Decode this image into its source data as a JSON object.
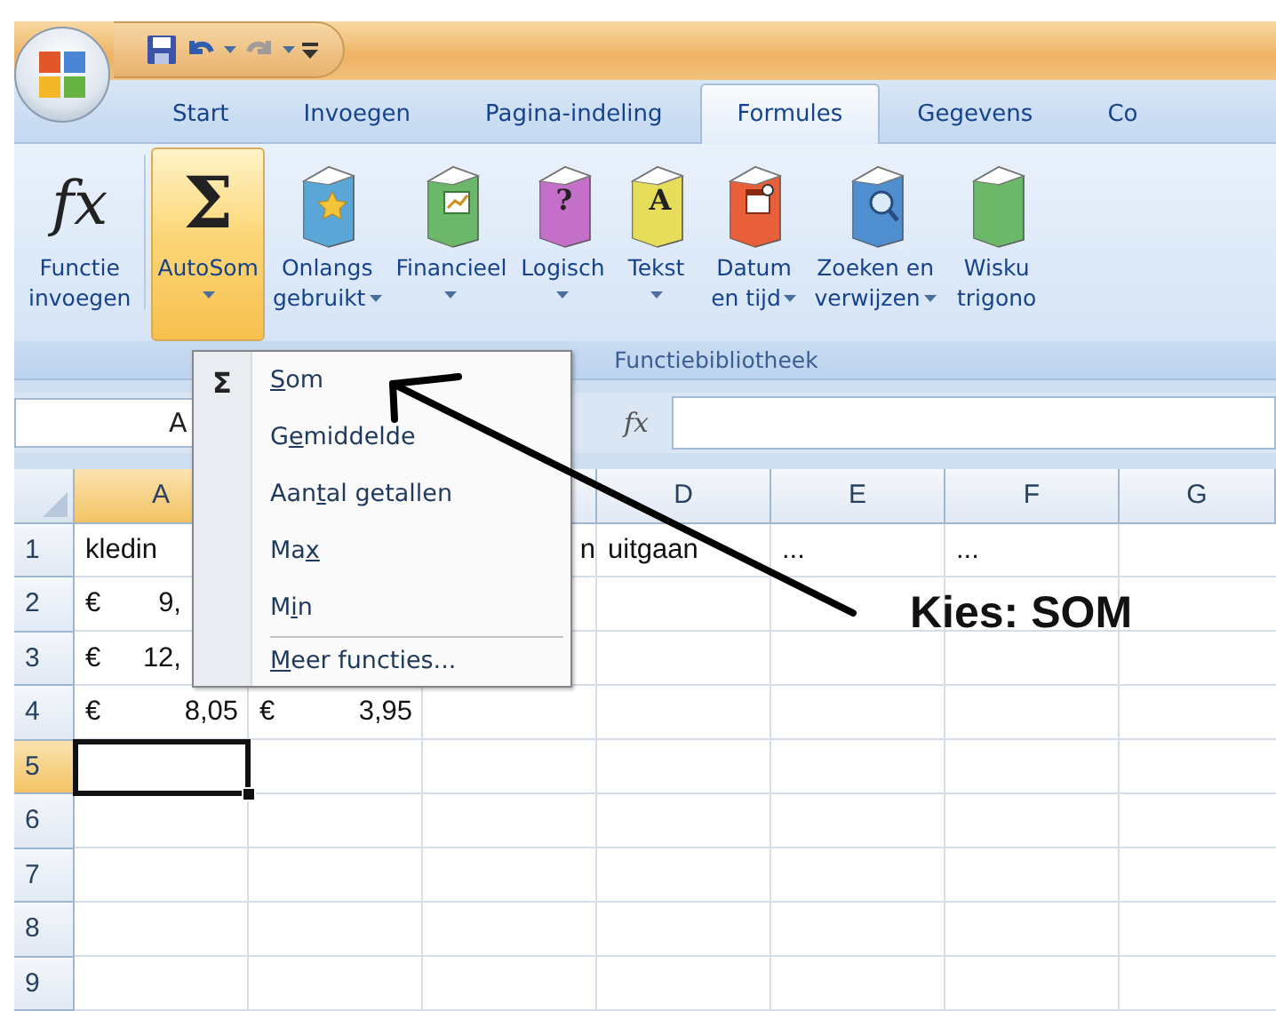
{
  "quick_access": [
    {
      "kind": "save",
      "disabled": false,
      "has_menu": false
    },
    {
      "kind": "undo",
      "disabled": false,
      "has_menu": true
    },
    {
      "kind": "redo",
      "disabled": true,
      "has_menu": true
    },
    {
      "kind": "customize",
      "disabled": false,
      "has_menu": false
    }
  ],
  "tabs": [
    {
      "label": "Start",
      "selected": false
    },
    {
      "label": "Invoegen",
      "selected": false
    },
    {
      "label": "Pagina-indeling",
      "selected": false
    },
    {
      "label": "Formules",
      "selected": true
    },
    {
      "label": "Gegevens",
      "selected": false
    },
    {
      "label": "Co",
      "selected": false
    }
  ],
  "ribbon": {
    "buttons": [
      {
        "kind": "function",
        "lines": [
          "Functie",
          "invoegen"
        ],
        "glyph": "fx",
        "has_menu": false,
        "active": false
      },
      {
        "kind": "sum",
        "lines": [
          "AutoSom"
        ],
        "glyph": "Σ",
        "has_menu": true,
        "active": true
      },
      {
        "kind": "recent",
        "lines": [
          "Onlangs",
          "gebruikt"
        ],
        "color": "#5aa6d6",
        "has_menu": true,
        "active": false
      },
      {
        "kind": "financial",
        "lines": [
          "Financieel"
        ],
        "color": "#6cb86a",
        "has_menu": true,
        "active": false
      },
      {
        "kind": "logical",
        "lines": [
          "Logisch"
        ],
        "color": "#c46fc8",
        "emblem_text": "?",
        "has_menu": true,
        "active": false
      },
      {
        "kind": "text",
        "lines": [
          "Tekst"
        ],
        "color": "#e6de5a",
        "emblem_text": "A",
        "has_menu": true,
        "active": false
      },
      {
        "kind": "date",
        "lines": [
          "Datum",
          "en tijd"
        ],
        "color": "#e8603a",
        "has_menu": true,
        "active": false
      },
      {
        "kind": "lookup",
        "lines": [
          "Zoeken en",
          "verwijzen"
        ],
        "color": "#4f8fd0",
        "has_menu": true,
        "active": false
      },
      {
        "kind": "math",
        "lines": [
          "Wisku",
          "trigono"
        ],
        "color": "#6cb86a",
        "has_menu": false,
        "active": false
      }
    ],
    "group_label": "Functiebibliotheek"
  },
  "name_box": "A",
  "formula_icon": "fx",
  "columns": [
    {
      "label": "A",
      "selected": true
    },
    null,
    null,
    {
      "label": "D",
      "selected": false
    },
    {
      "label": "E",
      "selected": false
    },
    {
      "label": "F",
      "selected": false
    },
    {
      "label": "G",
      "selected": false
    }
  ],
  "rows": [
    {
      "header": "1",
      "selected": false,
      "cells": [
        {
          "text": "kledin"
        },
        null,
        {
          "text": "n",
          "right_aligned": true
        },
        {
          "text": "uitgaan"
        },
        {
          "text": "..."
        },
        {
          "text": "..."
        },
        null
      ]
    },
    {
      "header": "2",
      "selected": false,
      "cells": [
        {
          "currency": "€",
          "amount": "9,",
          "covered": true
        },
        null,
        null,
        null,
        null,
        null,
        null
      ]
    },
    {
      "header": "3",
      "selected": false,
      "cells": [
        {
          "currency": "€",
          "amount": "12,",
          "covered": true
        },
        null,
        null,
        null,
        null,
        null,
        null
      ]
    },
    {
      "header": "4",
      "selected": false,
      "cells": [
        {
          "currency": "€",
          "amount": "8,05"
        },
        {
          "currency": "€",
          "amount": "3,95"
        },
        null,
        null,
        null,
        null,
        null
      ]
    },
    {
      "header": "5",
      "selected": true,
      "cells": [
        null,
        null,
        null,
        null,
        null,
        null,
        null
      ]
    },
    {
      "header": "6",
      "selected": false,
      "cells": [
        null,
        null,
        null,
        null,
        null,
        null,
        null
      ]
    },
    {
      "header": "7",
      "selected": false,
      "cells": [
        null,
        null,
        null,
        null,
        null,
        null,
        null
      ]
    },
    {
      "header": "8",
      "selected": false,
      "cells": [
        null,
        null,
        null,
        null,
        null,
        null,
        null
      ]
    },
    {
      "header": "9",
      "selected": false,
      "cells": [
        null,
        null,
        null,
        null,
        null,
        null,
        null
      ]
    }
  ],
  "menu": {
    "glyph": "Σ",
    "items": [
      {
        "key": "S",
        "after": "om",
        "separator_before": false
      },
      {
        "before": "G",
        "key": "e",
        "after": "middelde",
        "separator_before": false
      },
      {
        "before": "Aan",
        "key": "t",
        "after": "al getallen",
        "separator_before": false
      },
      {
        "before": "Ma",
        "key": "x",
        "separator_before": false
      },
      {
        "before": "M",
        "key": "i",
        "after": "n",
        "separator_before": false
      },
      {
        "key": "M",
        "after": "eer functies...",
        "separator_before": true
      }
    ]
  },
  "annotation": {
    "text": "Kies: SOM"
  }
}
